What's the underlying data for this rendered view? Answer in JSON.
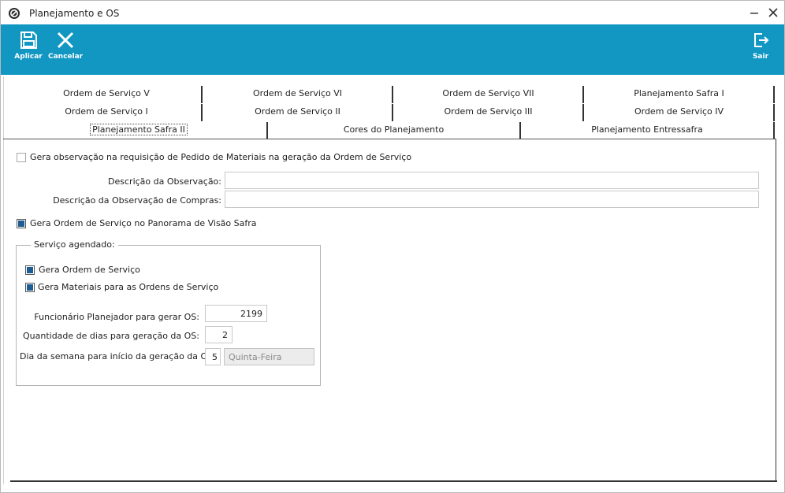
{
  "window": {
    "title": "Planejamento e OS",
    "minimize_label": "—",
    "close_label": "✕"
  },
  "toolbar": {
    "color": "#1197c2",
    "apply_label": "Aplicar",
    "cancel_label": "Cancelar",
    "exit_label": "Sair"
  },
  "tabs": {
    "row1": [
      "Ordem de Serviço V",
      "Ordem de Serviço VI",
      "Ordem de Serviço VII",
      "Planejamento Safra I"
    ],
    "row2": [
      "Ordem de Serviço I",
      "Ordem de Serviço II",
      "Ordem de Serviço III",
      "Ordem de Serviço IV"
    ],
    "row3": [
      "Planejamento Safra II",
      "Cores do Planejamento",
      "Planejamento Entressafra"
    ],
    "active": "Planejamento Safra II"
  },
  "form": {
    "gera_observacao": {
      "label": "Gera observação na requisição de Pedido de Materiais na geração da Ordem de Serviço",
      "checked": false
    },
    "descricao_observacao": {
      "label": "Descrição da Observação:",
      "value": ""
    },
    "descricao_observacao_compras": {
      "label": "Descrição da Observação de Compras:",
      "value": ""
    },
    "gera_os_panorama": {
      "label": "Gera Ordem de Serviço no Panorama de Visão Safra",
      "checked": true
    },
    "servico_agendado": {
      "title": "Serviço agendado:",
      "gera_os": {
        "label": "Gera Ordem de Serviço",
        "checked": true
      },
      "gera_materiais": {
        "label": "Gera Materiais para as Ordens de Serviço",
        "checked": true
      },
      "funcionario": {
        "label": "Funcionário Planejador para gerar OS:",
        "value": "2199"
      },
      "quantidade_dias": {
        "label": "Quantidade de dias para geração da OS:",
        "value": "2"
      },
      "dia_semana": {
        "label": "Dia da semana para início da geração da OS:",
        "value": "5",
        "name": "Quinta-Feira"
      }
    }
  }
}
